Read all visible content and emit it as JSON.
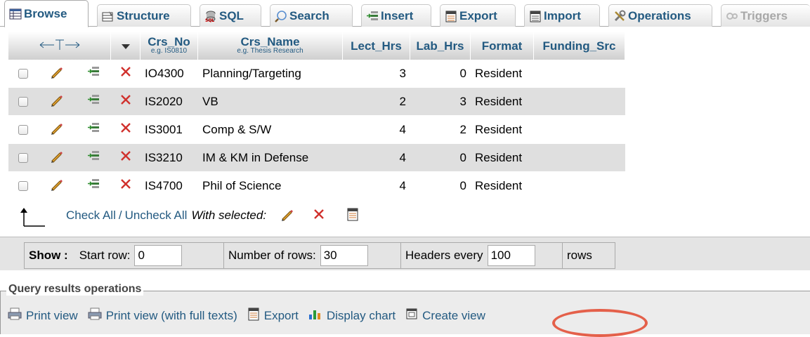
{
  "tabs": [
    {
      "label": "Browse",
      "icon": "browse-icon",
      "active": true
    },
    {
      "label": "Structure",
      "icon": "structure-icon"
    },
    {
      "label": "SQL",
      "icon": "sql-icon"
    },
    {
      "label": "Search",
      "icon": "search-icon"
    },
    {
      "label": "Insert",
      "icon": "insert-icon"
    },
    {
      "label": "Export",
      "icon": "export-icon"
    },
    {
      "label": "Import",
      "icon": "import-icon"
    },
    {
      "label": "Operations",
      "icon": "operations-icon"
    },
    {
      "label": "Triggers",
      "icon": "triggers-icon",
      "disabled": true
    }
  ],
  "table": {
    "columns": [
      {
        "label": "Crs_No",
        "sub": "e.g. IS0810"
      },
      {
        "label": "Crs_Name",
        "sub": "e.g. Thesis Research"
      },
      {
        "label": "Lect_Hrs",
        "sub": ""
      },
      {
        "label": "Lab_Hrs",
        "sub": ""
      },
      {
        "label": "Format",
        "sub": ""
      },
      {
        "label": "Funding_Src",
        "sub": ""
      }
    ],
    "rows": [
      {
        "crs_no": "IO4300",
        "crs_name": "Planning/Targeting",
        "lect_hrs": "3",
        "lab_hrs": "0",
        "format": "Resident",
        "funding_src": ""
      },
      {
        "crs_no": "IS2020",
        "crs_name": "VB",
        "lect_hrs": "2",
        "lab_hrs": "3",
        "format": "Resident",
        "funding_src": ""
      },
      {
        "crs_no": "IS3001",
        "crs_name": "Comp & S/W",
        "lect_hrs": "4",
        "lab_hrs": "2",
        "format": "Resident",
        "funding_src": ""
      },
      {
        "crs_no": "IS3210",
        "crs_name": "IM & KM in Defense",
        "lect_hrs": "4",
        "lab_hrs": "0",
        "format": "Resident",
        "funding_src": ""
      },
      {
        "crs_no": "IS4700",
        "crs_name": "Phil of Science",
        "lect_hrs": "4",
        "lab_hrs": "0",
        "format": "Resident",
        "funding_src": ""
      }
    ]
  },
  "checkall": {
    "check_all": "Check All",
    "separator": "/",
    "uncheck_all": "Uncheck All",
    "with_selected": "With selected:"
  },
  "show": {
    "label": "Show :",
    "start_row_label": "Start row:",
    "start_row_value": "0",
    "num_rows_label": "Number of rows:",
    "num_rows_value": "30",
    "headers_every_label": "Headers every",
    "headers_every_value": "100",
    "rows_label": "rows"
  },
  "query_ops": {
    "legend": "Query results operations",
    "print_view": "Print view",
    "print_view_full": "Print view (with full texts)",
    "export": "Export",
    "display_chart": "Display chart",
    "create_view": "Create view"
  },
  "colors": {
    "link": "#235a81",
    "highlight_oval": "#e4604a",
    "row_even": "#dfdfdf"
  }
}
